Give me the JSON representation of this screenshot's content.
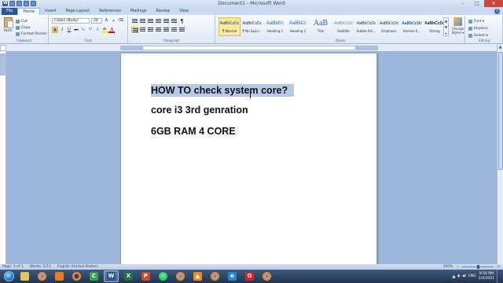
{
  "window": {
    "title": "Document1 - Microsoft Word",
    "controls": {
      "minimize": "–",
      "maximize": "□",
      "close": "✕"
    }
  },
  "quick_access": {
    "icons": [
      "word-icon",
      "save-icon",
      "undo-icon",
      "redo-icon",
      "customize-icon"
    ]
  },
  "tabs": [
    {
      "label": "File"
    },
    {
      "label": "Home"
    },
    {
      "label": "Insert"
    },
    {
      "label": "Page Layout"
    },
    {
      "label": "References"
    },
    {
      "label": "Mailings"
    },
    {
      "label": "Review"
    },
    {
      "label": "View"
    }
  ],
  "ribbon": {
    "clipboard": {
      "label": "Clipboard",
      "paste": "Paste",
      "cut": "Cut",
      "copy": "Copy",
      "format_painter": "Format Painter"
    },
    "font": {
      "label": "Font",
      "font_name": "Calibri (Body)",
      "font_size": "26",
      "grow": "A",
      "shrink": "A",
      "bold": "B",
      "italic": "I",
      "underline": "U",
      "strike": "abc",
      "subscript": "x₂",
      "superscript": "x²",
      "highlight": "ab",
      "font_color": "A"
    },
    "paragraph": {
      "label": "Paragraph",
      "show_marks": "¶"
    },
    "styles": {
      "label": "Styles",
      "items": [
        {
          "sample": "AaBbCcDc",
          "name": "¶ Normal"
        },
        {
          "sample": "AaBbCcDc",
          "name": "¶ No Spaci..."
        },
        {
          "sample": "AaBbCc",
          "name": "Heading 1"
        },
        {
          "sample": "AaBbCc",
          "name": "Heading 2"
        },
        {
          "sample": "AaB",
          "name": "Title"
        },
        {
          "sample": "AaBbCcDc",
          "name": "Subtitle"
        },
        {
          "sample": "AaBbCcDc",
          "name": "Subtle Em..."
        },
        {
          "sample": "AaBbCcDc",
          "name": "Emphasis"
        },
        {
          "sample": "AaBbCcDc",
          "name": "Intense E..."
        },
        {
          "sample": "AaBbCcDc",
          "name": "Strong"
        }
      ],
      "change_styles": "Change Styles ▾"
    },
    "editing": {
      "label": "Editing",
      "find": "Find ▾",
      "replace": "Replace",
      "select": "Select ▾"
    }
  },
  "document": {
    "lines": [
      "HOW TO check system core?",
      "core i3 3rd genration",
      "6GB RAM 4 CORE"
    ]
  },
  "statusbar": {
    "page": "Page: 1 of 1",
    "words": "Words: 5/13",
    "language": "English (United States)",
    "zoom": "100%"
  },
  "taskbar": {
    "apps": [
      "folder-icon",
      "chrome-icon",
      "media-player-icon",
      "firefox-icon",
      "camtasia-icon",
      "word-icon",
      "excel-icon",
      "powerpoint-icon",
      "whatsapp-icon",
      "chrome-icon",
      "vlc-icon",
      "chrome-icon",
      "edge-icon",
      "opera-icon",
      "chrome-icon"
    ],
    "language": "ENG",
    "time": "9:54 PM",
    "date": "2/4/2021"
  },
  "colors": {
    "ribbon_bg": "#dfe9f5",
    "file_tab": "#2b5797",
    "selection": "#b7c9e6",
    "doc_bg": "#9eb6dc",
    "taskbar": "#22344d"
  }
}
